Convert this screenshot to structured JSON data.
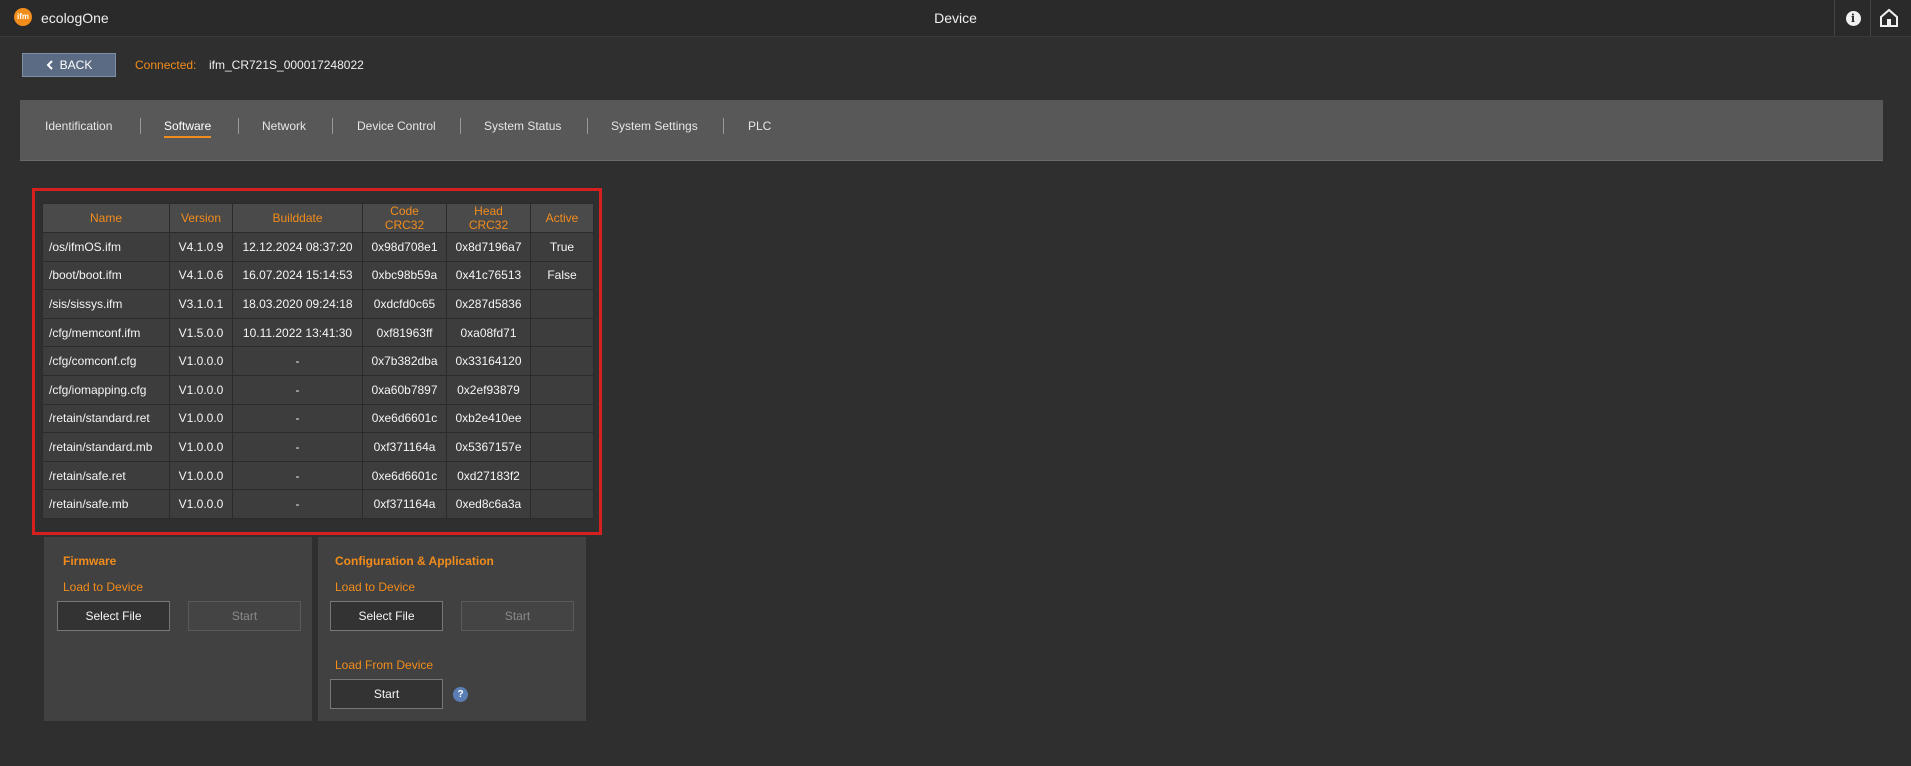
{
  "app": {
    "name": "ecologOne",
    "logo_text": "ifm"
  },
  "window": {
    "title": "Device"
  },
  "topbar": {
    "info_icon": "info-icon",
    "home_icon": "home-icon"
  },
  "nav": {
    "back_label": "BACK",
    "connected_label": "Connected:",
    "connected_device": "ifm_CR721S_000017248022"
  },
  "tabs": [
    {
      "label": "Identification",
      "active": false
    },
    {
      "label": "Software",
      "active": true
    },
    {
      "label": "Network",
      "active": false
    },
    {
      "label": "Device Control",
      "active": false
    },
    {
      "label": "System Status",
      "active": false
    },
    {
      "label": "System Settings",
      "active": false
    },
    {
      "label": "PLC",
      "active": false
    }
  ],
  "software_table": {
    "headers": [
      "Name",
      "Version",
      "Builddate",
      "Code CRC32",
      "Head CRC32",
      "Active"
    ],
    "rows": [
      [
        "/os/ifmOS.ifm",
        "V4.1.0.9",
        "12.12.2024 08:37:20",
        "0x98d708e1",
        "0x8d7196a7",
        "True"
      ],
      [
        "/boot/boot.ifm",
        "V4.1.0.6",
        "16.07.2024 15:14:53",
        "0xbc98b59a",
        "0x41c76513",
        "False"
      ],
      [
        "/sis/sissys.ifm",
        "V3.1.0.1",
        "18.03.2020 09:24:18",
        "0xdcfd0c65",
        "0x287d5836",
        ""
      ],
      [
        "/cfg/memconf.ifm",
        "V1.5.0.0",
        "10.11.2022 13:41:30",
        "0xf81963ff",
        "0xa08fd71",
        ""
      ],
      [
        "/cfg/comconf.cfg",
        "V1.0.0.0",
        "-",
        "0x7b382dba",
        "0x33164120",
        ""
      ],
      [
        "/cfg/iomapping.cfg",
        "V1.0.0.0",
        "-",
        "0xa60b7897",
        "0x2ef93879",
        ""
      ],
      [
        "/retain/standard.ret",
        "V1.0.0.0",
        "-",
        "0xe6d6601c",
        "0xb2e410ee",
        ""
      ],
      [
        "/retain/standard.mb",
        "V1.0.0.0",
        "-",
        "0xf371164a",
        "0x5367157e",
        ""
      ],
      [
        "/retain/safe.ret",
        "V1.0.0.0",
        "-",
        "0xe6d6601c",
        "0xd27183f2",
        ""
      ],
      [
        "/retain/safe.mb",
        "V1.0.0.0",
        "-",
        "0xf371164a",
        "0xed8c6a3a",
        ""
      ]
    ]
  },
  "firmware": {
    "title": "Firmware",
    "load_to_device": "Load to Device",
    "select_file": "Select File",
    "start": "Start"
  },
  "config_app": {
    "title": "Configuration & Application",
    "load_to_device": "Load to Device",
    "select_file": "Select File",
    "start": "Start",
    "load_from_device": "Load From Device",
    "start_from_device": "Start",
    "help_icon": "?"
  },
  "colors": {
    "accent": "#f28c1b",
    "highlight_border": "#d62020",
    "back_button": "#5b6b84",
    "help": "#5b7fb5"
  }
}
